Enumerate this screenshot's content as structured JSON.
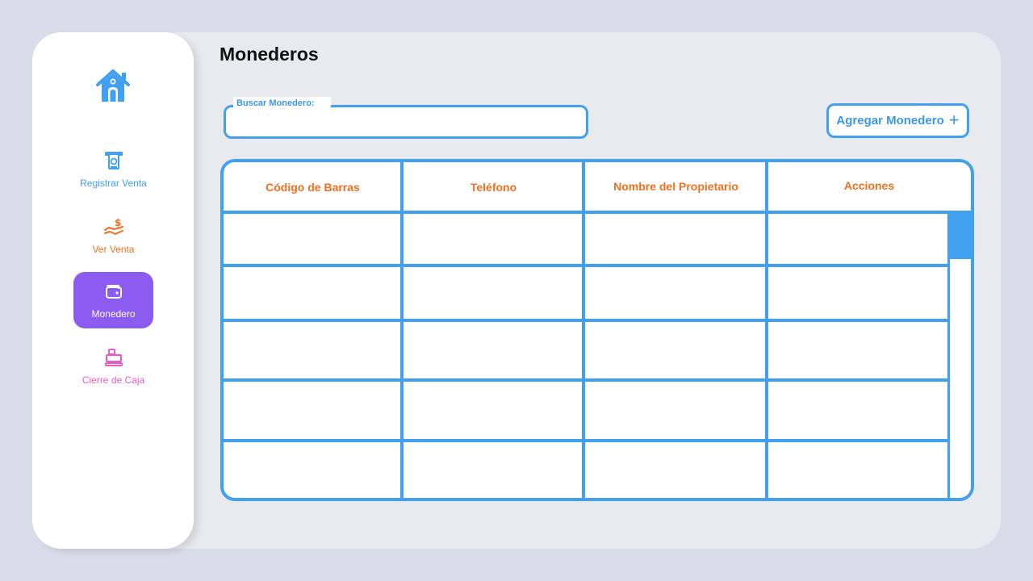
{
  "sidebar": {
    "home_icon": "home-icon",
    "items": [
      {
        "label": "Registrar Venta",
        "icon": "atm-cash-icon",
        "color": "#41a0f0",
        "active": false
      },
      {
        "label": "Ver Venta",
        "icon": "money-hand-icon",
        "color": "#f0701e",
        "active": false
      },
      {
        "label": "Monedero",
        "icon": "wallet-icon",
        "color": "#ffffff",
        "active": true
      },
      {
        "label": "Cierre de Caja",
        "icon": "cash-register-icon",
        "color": "#e85cc8",
        "active": false
      }
    ]
  },
  "main": {
    "title": "Monederos",
    "search": {
      "label": "Buscar Monedero:",
      "value": ""
    },
    "add_button": {
      "label": "Agregar Monedero",
      "icon": "plus-icon"
    },
    "table": {
      "columns": [
        "Código de Barras",
        "Teléfono",
        "Nombre del Propietario",
        "Acciones"
      ],
      "rows": [
        [
          "",
          "",
          "",
          ""
        ],
        [
          "",
          "",
          "",
          ""
        ],
        [
          "",
          "",
          "",
          ""
        ],
        [
          "",
          "",
          "",
          ""
        ],
        [
          "",
          "",
          "",
          ""
        ]
      ]
    }
  },
  "colors": {
    "accent_blue": "#41a0f0",
    "accent_orange": "#f0701e",
    "accent_purple": "#8c5cf0",
    "accent_pink": "#e85cc8",
    "background": "#d8dde9",
    "panel": "#e8eaf0"
  }
}
